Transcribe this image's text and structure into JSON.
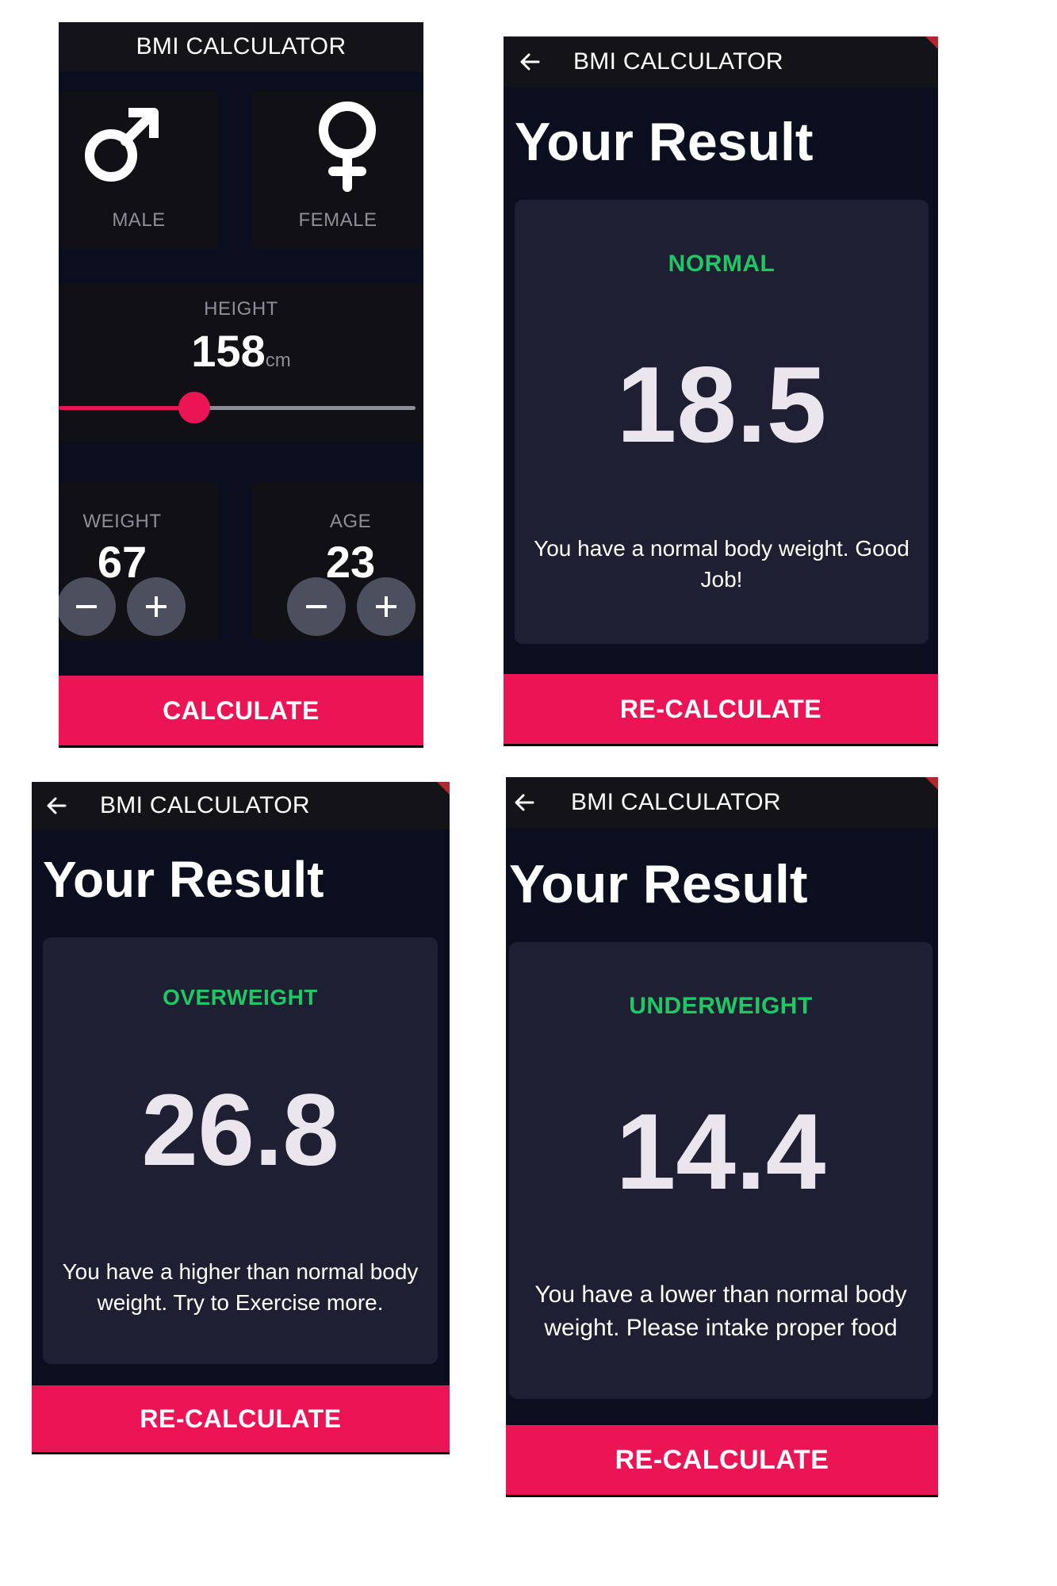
{
  "input_screen": {
    "title": "BMI CALCULATOR",
    "gender_cards": [
      {
        "label": "MALE",
        "icon": "male-symbol-icon"
      },
      {
        "label": "FEMALE",
        "icon": "female-symbol-icon"
      }
    ],
    "height": {
      "label": "HEIGHT",
      "value": "158",
      "unit": "cm",
      "slider_fraction": 0.38
    },
    "weight": {
      "label": "WEIGHT",
      "value": "67"
    },
    "age": {
      "label": "AGE",
      "value": "23"
    },
    "calculate_label": "CALCULATE"
  },
  "result_screens": [
    {
      "title": "BMI CALCULATOR",
      "heading": "Your Result",
      "status": "NORMAL",
      "bmi": "18.5",
      "advice": "You have a normal body weight. Good Job!",
      "button_label": "RE-CALCULATE"
    },
    {
      "title": "BMI CALCULATOR",
      "heading": "Your Result",
      "status": "OVERWEIGHT",
      "bmi": "26.8",
      "advice": "You have a higher than normal body weight. Try to Exercise more.",
      "button_label": "RE-CALCULATE"
    },
    {
      "title": "BMI CALCULATOR",
      "heading": "Your Result",
      "status": "UNDERWEIGHT",
      "bmi": "14.4",
      "advice": "You have a lower than normal body weight. Please intake proper food",
      "button_label": "RE-CALCULATE"
    }
  ],
  "colors": {
    "background": "#0a0e1f",
    "card": "#1e1f33",
    "accent": "#eb1555",
    "status_green": "#21c764",
    "label_gray": "#8d8e98"
  }
}
